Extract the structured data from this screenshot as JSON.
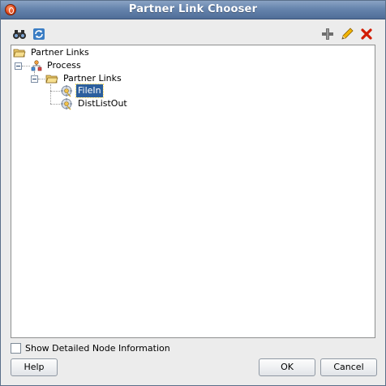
{
  "window": {
    "title": "Partner Link Chooser"
  },
  "toolbar": {
    "left": [
      "binoculars-icon",
      "refresh-icon"
    ],
    "right": [
      "add-icon",
      "edit-icon",
      "delete-icon"
    ]
  },
  "tree": {
    "root": "Partner Links",
    "process": "Process",
    "partner_links": "Partner Links",
    "items": [
      "FileIn",
      "DistListOut"
    ],
    "selected": "FileIn"
  },
  "options": {
    "show_detail_label": "Show Detailed Node Information",
    "show_detail_checked": false
  },
  "buttons": {
    "help": "Help",
    "ok": "OK",
    "cancel": "Cancel"
  },
  "colors": {
    "titlebar": "#6684ad",
    "selection": "#2b5f9e",
    "delete": "#d21b00",
    "add": "#6e6e6e",
    "edit": "#e0a800"
  }
}
